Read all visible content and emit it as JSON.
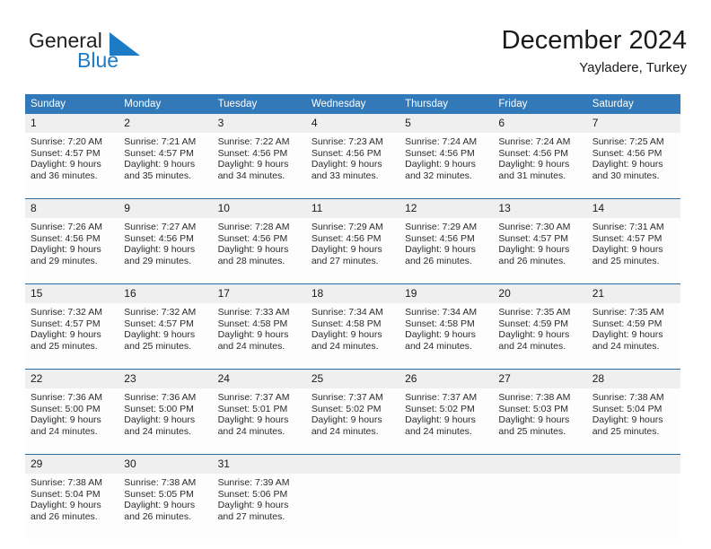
{
  "brand": {
    "name_part1": "General",
    "name_part2": "Blue",
    "triangle_color": "#1b7bc4"
  },
  "header": {
    "title": "December 2024",
    "subtitle": "Yayladere, Turkey"
  },
  "theme": {
    "header_blue": "#3279b9",
    "separator_blue": "#2e6da4",
    "daynum_bg": "#efeff0",
    "cell_bg": "#fdfdfd"
  },
  "weekday_headers": [
    "Sunday",
    "Monday",
    "Tuesday",
    "Wednesday",
    "Thursday",
    "Friday",
    "Saturday"
  ],
  "weeks": [
    [
      {
        "day": "1",
        "sunrise": "Sunrise: 7:20 AM",
        "sunset": "Sunset: 4:57 PM",
        "daylight1": "Daylight: 9 hours",
        "daylight2": "and 36 minutes."
      },
      {
        "day": "2",
        "sunrise": "Sunrise: 7:21 AM",
        "sunset": "Sunset: 4:57 PM",
        "daylight1": "Daylight: 9 hours",
        "daylight2": "and 35 minutes."
      },
      {
        "day": "3",
        "sunrise": "Sunrise: 7:22 AM",
        "sunset": "Sunset: 4:56 PM",
        "daylight1": "Daylight: 9 hours",
        "daylight2": "and 34 minutes."
      },
      {
        "day": "4",
        "sunrise": "Sunrise: 7:23 AM",
        "sunset": "Sunset: 4:56 PM",
        "daylight1": "Daylight: 9 hours",
        "daylight2": "and 33 minutes."
      },
      {
        "day": "5",
        "sunrise": "Sunrise: 7:24 AM",
        "sunset": "Sunset: 4:56 PM",
        "daylight1": "Daylight: 9 hours",
        "daylight2": "and 32 minutes."
      },
      {
        "day": "6",
        "sunrise": "Sunrise: 7:24 AM",
        "sunset": "Sunset: 4:56 PM",
        "daylight1": "Daylight: 9 hours",
        "daylight2": "and 31 minutes."
      },
      {
        "day": "7",
        "sunrise": "Sunrise: 7:25 AM",
        "sunset": "Sunset: 4:56 PM",
        "daylight1": "Daylight: 9 hours",
        "daylight2": "and 30 minutes."
      }
    ],
    [
      {
        "day": "8",
        "sunrise": "Sunrise: 7:26 AM",
        "sunset": "Sunset: 4:56 PM",
        "daylight1": "Daylight: 9 hours",
        "daylight2": "and 29 minutes."
      },
      {
        "day": "9",
        "sunrise": "Sunrise: 7:27 AM",
        "sunset": "Sunset: 4:56 PM",
        "daylight1": "Daylight: 9 hours",
        "daylight2": "and 29 minutes."
      },
      {
        "day": "10",
        "sunrise": "Sunrise: 7:28 AM",
        "sunset": "Sunset: 4:56 PM",
        "daylight1": "Daylight: 9 hours",
        "daylight2": "and 28 minutes."
      },
      {
        "day": "11",
        "sunrise": "Sunrise: 7:29 AM",
        "sunset": "Sunset: 4:56 PM",
        "daylight1": "Daylight: 9 hours",
        "daylight2": "and 27 minutes."
      },
      {
        "day": "12",
        "sunrise": "Sunrise: 7:29 AM",
        "sunset": "Sunset: 4:56 PM",
        "daylight1": "Daylight: 9 hours",
        "daylight2": "and 26 minutes."
      },
      {
        "day": "13",
        "sunrise": "Sunrise: 7:30 AM",
        "sunset": "Sunset: 4:57 PM",
        "daylight1": "Daylight: 9 hours",
        "daylight2": "and 26 minutes."
      },
      {
        "day": "14",
        "sunrise": "Sunrise: 7:31 AM",
        "sunset": "Sunset: 4:57 PM",
        "daylight1": "Daylight: 9 hours",
        "daylight2": "and 25 minutes."
      }
    ],
    [
      {
        "day": "15",
        "sunrise": "Sunrise: 7:32 AM",
        "sunset": "Sunset: 4:57 PM",
        "daylight1": "Daylight: 9 hours",
        "daylight2": "and 25 minutes."
      },
      {
        "day": "16",
        "sunrise": "Sunrise: 7:32 AM",
        "sunset": "Sunset: 4:57 PM",
        "daylight1": "Daylight: 9 hours",
        "daylight2": "and 25 minutes."
      },
      {
        "day": "17",
        "sunrise": "Sunrise: 7:33 AM",
        "sunset": "Sunset: 4:58 PM",
        "daylight1": "Daylight: 9 hours",
        "daylight2": "and 24 minutes."
      },
      {
        "day": "18",
        "sunrise": "Sunrise: 7:34 AM",
        "sunset": "Sunset: 4:58 PM",
        "daylight1": "Daylight: 9 hours",
        "daylight2": "and 24 minutes."
      },
      {
        "day": "19",
        "sunrise": "Sunrise: 7:34 AM",
        "sunset": "Sunset: 4:58 PM",
        "daylight1": "Daylight: 9 hours",
        "daylight2": "and 24 minutes."
      },
      {
        "day": "20",
        "sunrise": "Sunrise: 7:35 AM",
        "sunset": "Sunset: 4:59 PM",
        "daylight1": "Daylight: 9 hours",
        "daylight2": "and 24 minutes."
      },
      {
        "day": "21",
        "sunrise": "Sunrise: 7:35 AM",
        "sunset": "Sunset: 4:59 PM",
        "daylight1": "Daylight: 9 hours",
        "daylight2": "and 24 minutes."
      }
    ],
    [
      {
        "day": "22",
        "sunrise": "Sunrise: 7:36 AM",
        "sunset": "Sunset: 5:00 PM",
        "daylight1": "Daylight: 9 hours",
        "daylight2": "and 24 minutes."
      },
      {
        "day": "23",
        "sunrise": "Sunrise: 7:36 AM",
        "sunset": "Sunset: 5:00 PM",
        "daylight1": "Daylight: 9 hours",
        "daylight2": "and 24 minutes."
      },
      {
        "day": "24",
        "sunrise": "Sunrise: 7:37 AM",
        "sunset": "Sunset: 5:01 PM",
        "daylight1": "Daylight: 9 hours",
        "daylight2": "and 24 minutes."
      },
      {
        "day": "25",
        "sunrise": "Sunrise: 7:37 AM",
        "sunset": "Sunset: 5:02 PM",
        "daylight1": "Daylight: 9 hours",
        "daylight2": "and 24 minutes."
      },
      {
        "day": "26",
        "sunrise": "Sunrise: 7:37 AM",
        "sunset": "Sunset: 5:02 PM",
        "daylight1": "Daylight: 9 hours",
        "daylight2": "and 24 minutes."
      },
      {
        "day": "27",
        "sunrise": "Sunrise: 7:38 AM",
        "sunset": "Sunset: 5:03 PM",
        "daylight1": "Daylight: 9 hours",
        "daylight2": "and 25 minutes."
      },
      {
        "day": "28",
        "sunrise": "Sunrise: 7:38 AM",
        "sunset": "Sunset: 5:04 PM",
        "daylight1": "Daylight: 9 hours",
        "daylight2": "and 25 minutes."
      }
    ],
    [
      {
        "day": "29",
        "sunrise": "Sunrise: 7:38 AM",
        "sunset": "Sunset: 5:04 PM",
        "daylight1": "Daylight: 9 hours",
        "daylight2": "and 26 minutes."
      },
      {
        "day": "30",
        "sunrise": "Sunrise: 7:38 AM",
        "sunset": "Sunset: 5:05 PM",
        "daylight1": "Daylight: 9 hours",
        "daylight2": "and 26 minutes."
      },
      {
        "day": "31",
        "sunrise": "Sunrise: 7:39 AM",
        "sunset": "Sunset: 5:06 PM",
        "daylight1": "Daylight: 9 hours",
        "daylight2": "and 27 minutes."
      },
      {
        "day": "",
        "sunrise": "",
        "sunset": "",
        "daylight1": "",
        "daylight2": ""
      },
      {
        "day": "",
        "sunrise": "",
        "sunset": "",
        "daylight1": "",
        "daylight2": ""
      },
      {
        "day": "",
        "sunrise": "",
        "sunset": "",
        "daylight1": "",
        "daylight2": ""
      },
      {
        "day": "",
        "sunrise": "",
        "sunset": "",
        "daylight1": "",
        "daylight2": ""
      }
    ]
  ]
}
